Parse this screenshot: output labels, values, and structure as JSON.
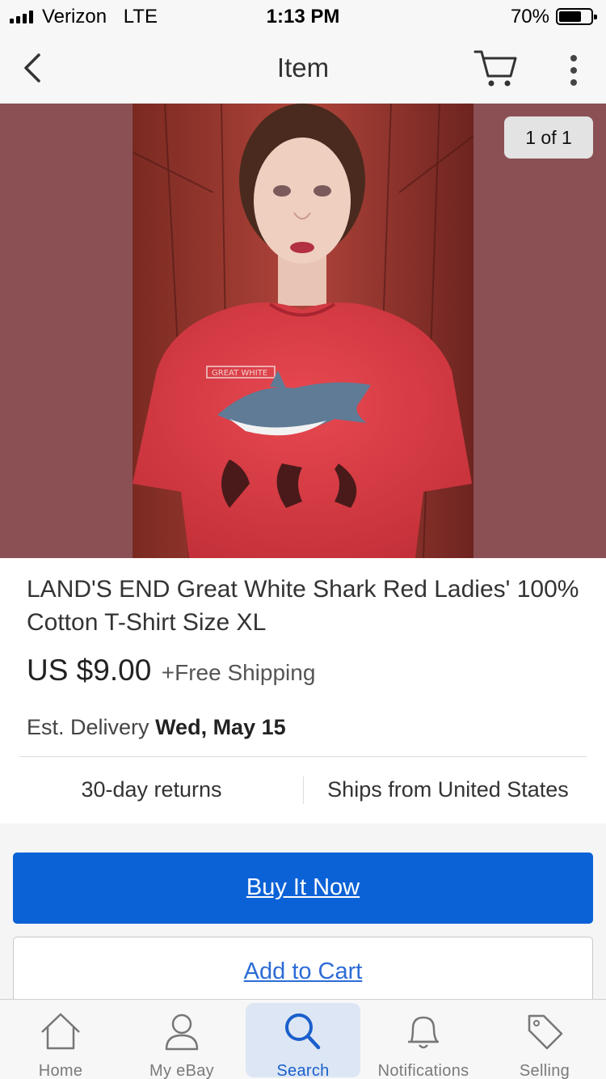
{
  "status_bar": {
    "carrier": "Verizon",
    "network": "LTE",
    "time": "1:13 PM",
    "battery": "70%",
    "battery_level": 0.7
  },
  "nav": {
    "title": "Item",
    "icons": [
      "chevron-left-icon",
      "cart-icon",
      "more-vertical-icon"
    ]
  },
  "gallery": {
    "counter": "1 of 1",
    "background_color": "#8a5054",
    "photo_shirt_text": "GREAT WHITE"
  },
  "item": {
    "title": "LAND'S END Great White Shark Red Ladies' 100% Cotton T-Shirt Size XL",
    "price": "US $9.00",
    "shipping": "+Free Shipping",
    "delivery_label": "Est. Delivery",
    "delivery_date": "Wed, May 15",
    "returns": "30-day returns",
    "ships_from": "Ships from United States"
  },
  "actions": {
    "buy_now": "Buy It Now",
    "add_to_cart": "Add to Cart",
    "accent_color": "#0b62d6"
  },
  "tabs": [
    {
      "label": "Home",
      "icon": "home-icon"
    },
    {
      "label": "My eBay",
      "icon": "user-icon"
    },
    {
      "label": "Search",
      "icon": "search-icon",
      "active": true
    },
    {
      "label": "Notifications",
      "icon": "bell-icon"
    },
    {
      "label": "Selling",
      "icon": "tag-icon"
    }
  ]
}
